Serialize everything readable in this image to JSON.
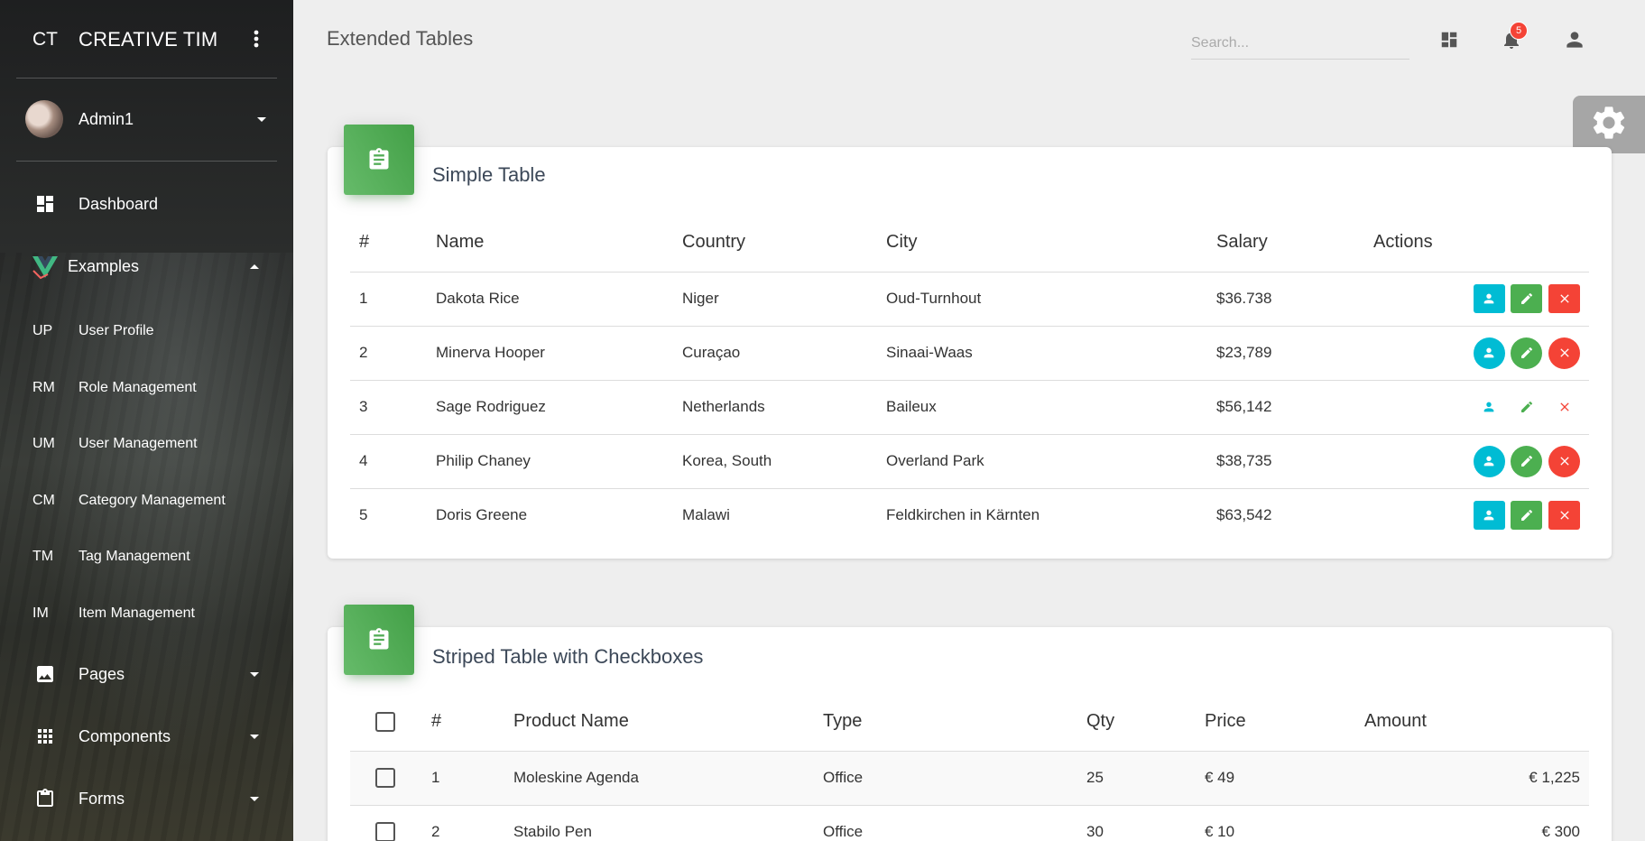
{
  "sidebar": {
    "logo_mini": "CT",
    "logo_text": "CREATIVE TIM",
    "user_name": "Admin1",
    "items": [
      {
        "label": "Dashboard"
      },
      {
        "label": "Examples"
      }
    ],
    "sub_items": [
      {
        "mini": "UP",
        "label": "User Profile"
      },
      {
        "mini": "RM",
        "label": "Role Management"
      },
      {
        "mini": "UM",
        "label": "User Management"
      },
      {
        "mini": "CM",
        "label": "Category Management"
      },
      {
        "mini": "TM",
        "label": "Tag Management"
      },
      {
        "mini": "IM",
        "label": "Item Management"
      }
    ],
    "bottom_items": [
      {
        "label": "Pages"
      },
      {
        "label": "Components"
      },
      {
        "label": "Forms"
      }
    ]
  },
  "header": {
    "title": "Extended Tables",
    "search_placeholder": "Search...",
    "notification_count": "5"
  },
  "colors": {
    "accent_green": "#4caf50",
    "info": "#00bcd4",
    "danger": "#f44336"
  },
  "simple_table": {
    "title": "Simple Table",
    "columns": [
      "#",
      "Name",
      "Country",
      "City",
      "Salary",
      "Actions"
    ],
    "rows": [
      {
        "id": "1",
        "name": "Dakota Rice",
        "country": "Niger",
        "city": "Oud-Turnhout",
        "salary": "$36.738"
      },
      {
        "id": "2",
        "name": "Minerva Hooper",
        "country": "Curaçao",
        "city": "Sinaai-Waas",
        "salary": "$23,789"
      },
      {
        "id": "3",
        "name": "Sage Rodriguez",
        "country": "Netherlands",
        "city": "Baileux",
        "salary": "$56,142"
      },
      {
        "id": "4",
        "name": "Philip Chaney",
        "country": "Korea, South",
        "city": "Overland Park",
        "salary": "$38,735"
      },
      {
        "id": "5",
        "name": "Doris Greene",
        "country": "Malawi",
        "city": "Feldkirchen in Kärnten",
        "salary": "$63,542"
      }
    ]
  },
  "striped_table": {
    "title": "Striped Table with Checkboxes",
    "columns": [
      "#",
      "Product Name",
      "Type",
      "Qty",
      "Price",
      "Amount"
    ],
    "rows": [
      {
        "id": "1",
        "product": "Moleskine Agenda",
        "type": "Office",
        "qty": "25",
        "price": "€ 49",
        "amount": "€ 1,225"
      },
      {
        "id": "2",
        "product": "Stabilo Pen",
        "type": "Office",
        "qty": "30",
        "price": "€ 10",
        "amount": "€ 300"
      }
    ]
  }
}
